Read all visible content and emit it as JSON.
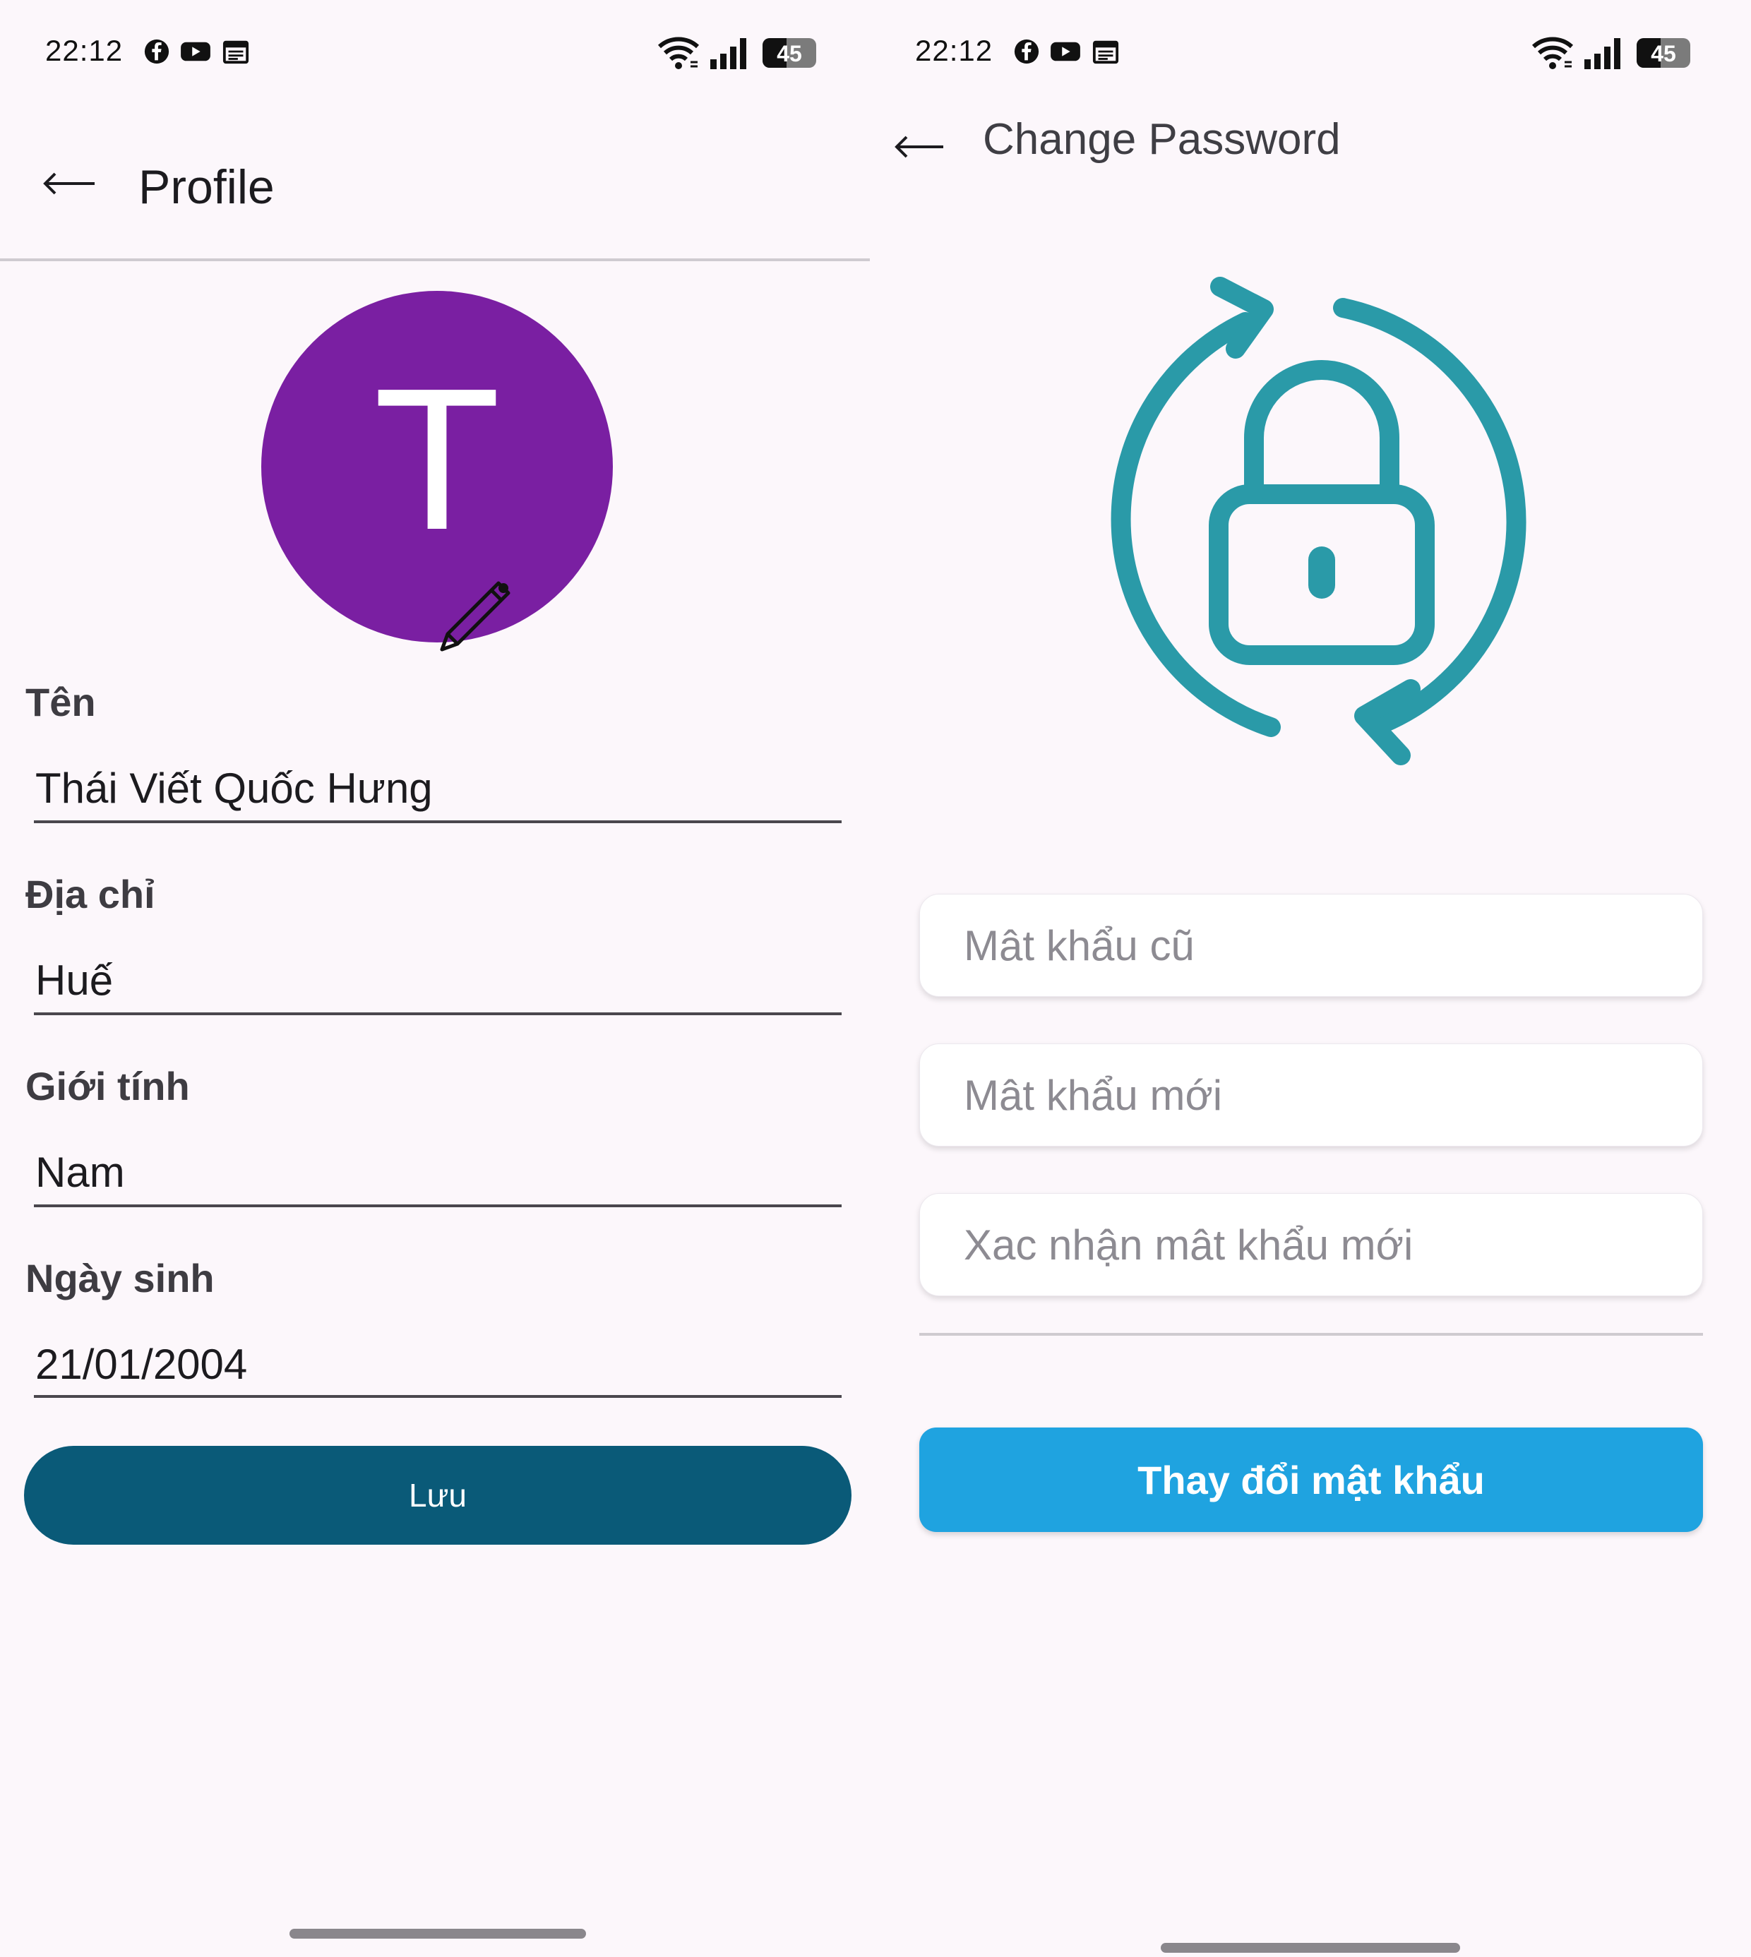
{
  "status_bar": {
    "time": "22:12",
    "battery": "45",
    "icons": [
      "facebook-icon",
      "youtube-icon",
      "calendar-icon",
      "wifi-icon",
      "signal-icon",
      "battery-icon"
    ]
  },
  "profile": {
    "title": "Profile",
    "avatar_letter": "T",
    "avatar_color": "#7a1fa2",
    "fields": [
      {
        "label": "Tên",
        "value": "Thái Viết Quốc Hưng"
      },
      {
        "label": "Địa chỉ",
        "value": "Huế"
      },
      {
        "label": "Giới tính",
        "value": "Nam"
      },
      {
        "label": "Ngày sinh",
        "value": "21/01/2004"
      }
    ],
    "save_label": "Lưu",
    "save_color": "#0a5a78"
  },
  "change_password": {
    "title": "Change Password",
    "old_placeholder": "Mât khẩu cũ",
    "new_placeholder": "Mât khẩu mới",
    "confirm_placeholder": "Xac nhận mât khẩu mới",
    "submit_label": "Thay đổi mật khẩu",
    "accent_color": "#2a9aa8",
    "button_color": "#1fa3e0"
  }
}
